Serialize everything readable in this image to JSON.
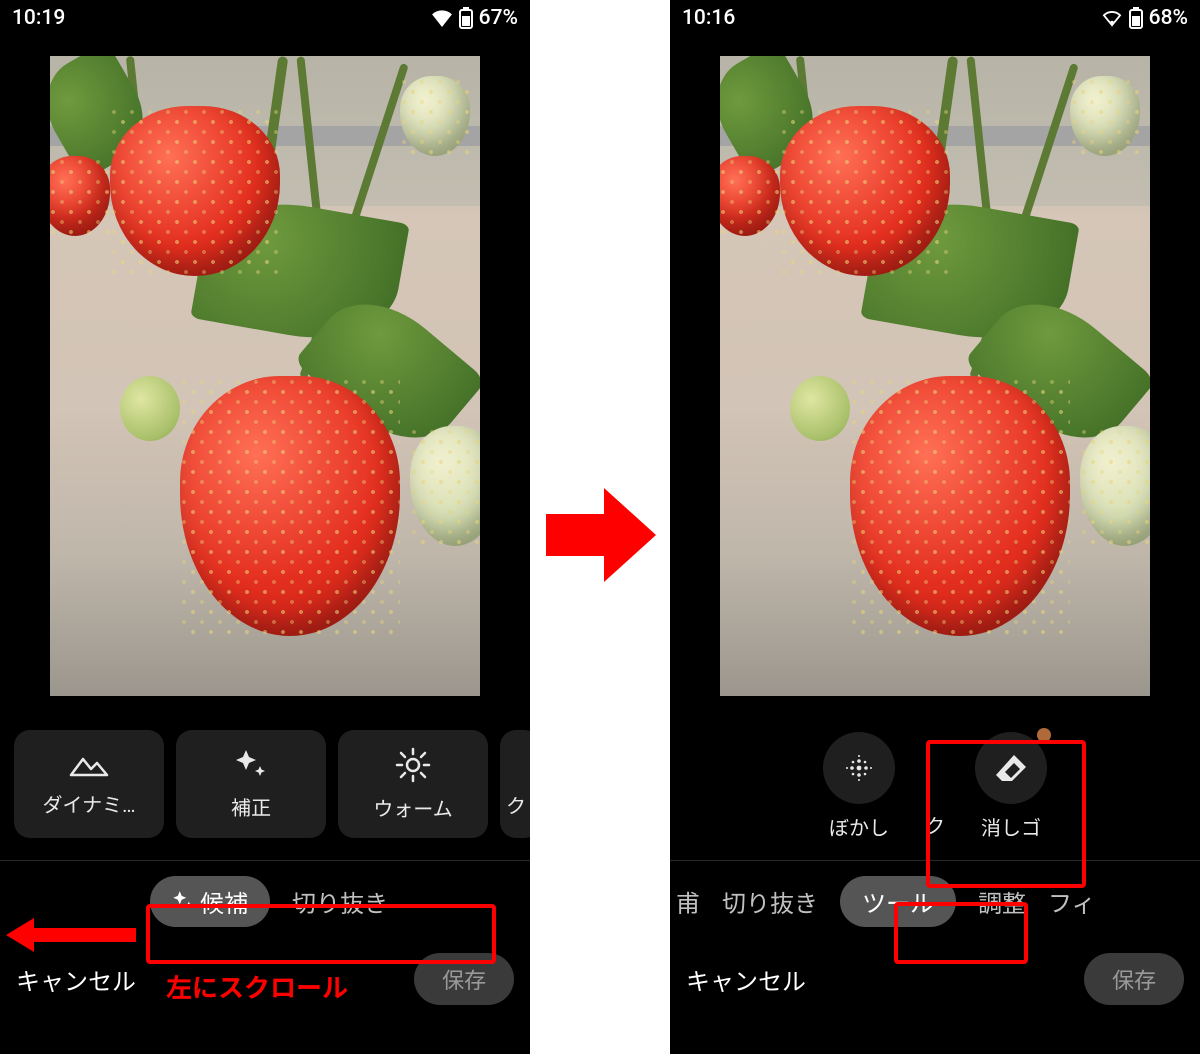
{
  "left": {
    "status": {
      "time": "10:19",
      "battery": "67%"
    },
    "suggestions": [
      {
        "label": "ダイナミ…"
      },
      {
        "label": "補正"
      },
      {
        "label": "ウォーム"
      }
    ],
    "suggestion_partial": "ク",
    "tabs": {
      "active": "候補",
      "next": "切り抜き"
    },
    "bottom": {
      "cancel": "キャンセル",
      "save": "保存"
    }
  },
  "right": {
    "status": {
      "time": "10:16",
      "battery": "68%"
    },
    "tools": {
      "blur": "ぼかし",
      "partial_prev": "ク",
      "eraser": "消しゴ"
    },
    "tabs": {
      "partial_first": "甫",
      "crop": "切り抜き",
      "active": "ツール",
      "adjust": "調整",
      "partial_last": "フィ"
    },
    "bottom": {
      "cancel": "キャンセル",
      "save": "保存"
    }
  },
  "annotation": {
    "scroll_hint": "左にスクロール"
  }
}
